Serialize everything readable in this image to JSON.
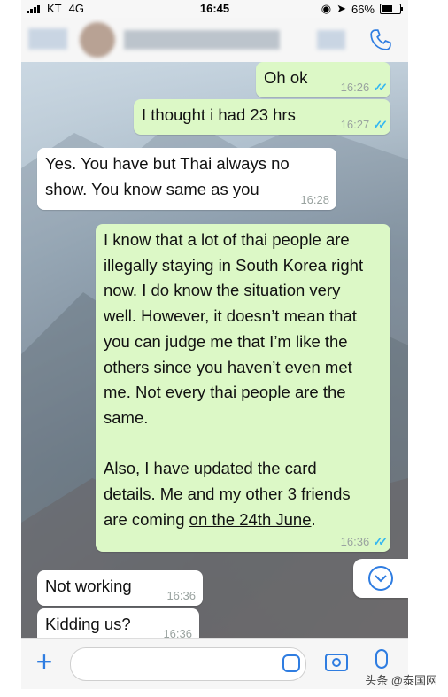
{
  "status": {
    "carrier": "KT",
    "network": "4G",
    "time": "16:45",
    "battery": "66%",
    "battery_level": 0.66
  },
  "header": {
    "call_icon": "phone-icon"
  },
  "messages": [
    {
      "dir": "out",
      "lines": [
        "Oh ok"
      ],
      "time": "16:26",
      "read": true
    },
    {
      "dir": "out",
      "lines": [
        "I thought i had 23 hrs"
      ],
      "time": "16:27",
      "read": true
    },
    {
      "dir": "in",
      "lines": [
        "Yes. You have but Thai always no",
        "show. You know same as you"
      ],
      "time": "16:28"
    },
    {
      "dir": "out",
      "lines": [
        "I know that a lot of thai people are",
        "illegally staying in South Korea right",
        "now. I do know the situation very",
        "well. However, it doesn’t mean that",
        "you can judge me that I’m like the",
        "others since you haven’t even met",
        "me. Not every thai people are the",
        "same.",
        "",
        "Also, I have updated the card",
        "details. Me and my other 3 friends"
      ],
      "last_prefix": "are coming ",
      "last_link": "on the 24th June",
      "last_suffix": ".",
      "time": "16:36",
      "read": true
    },
    {
      "dir": "in",
      "lines": [
        "Not working"
      ],
      "time": "16:36"
    },
    {
      "dir": "in",
      "lines": [
        "Kidding us?"
      ],
      "time": "16:36"
    }
  ],
  "footer": {
    "plus_icon": "+",
    "sticker_icon": "sticker-icon",
    "camera_icon": "camera-icon",
    "mic_icon": "microphone-icon"
  },
  "watermark": "头条 @泰国网",
  "colors": {
    "outgoing": "#dcf8c6",
    "incoming": "#ffffff",
    "accent": "#2f7de1",
    "tick": "#34b7f1"
  }
}
